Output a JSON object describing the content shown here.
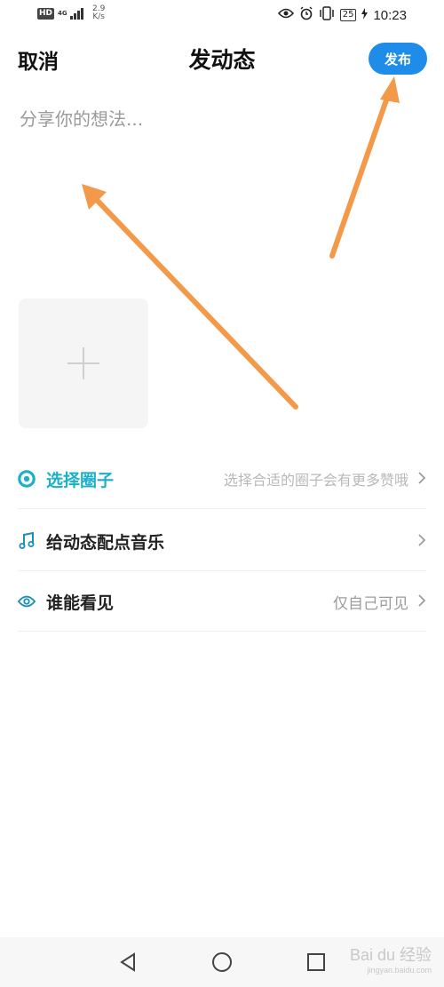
{
  "status_bar": {
    "hd": "HD",
    "network": "4G",
    "speed_value": "2.9",
    "speed_unit": "K/s",
    "battery": "25",
    "time": "10:23"
  },
  "header": {
    "cancel": "取消",
    "title": "发动态",
    "publish": "发布"
  },
  "composer": {
    "placeholder": "分享你的想法..."
  },
  "options": {
    "circle": {
      "label": "选择圈子",
      "hint": "选择合适的圈子会有更多赞哦"
    },
    "music": {
      "label": "给动态配点音乐"
    },
    "visibility": {
      "label": "谁能看见",
      "value": "仅自己可见"
    }
  },
  "colors": {
    "accent": "#1e8ce8",
    "teal": "#1bb0c8",
    "annotation": "#f39a4a"
  },
  "watermark": {
    "brand": "Bai du 经验",
    "url": "jingyan.baidu.com"
  }
}
